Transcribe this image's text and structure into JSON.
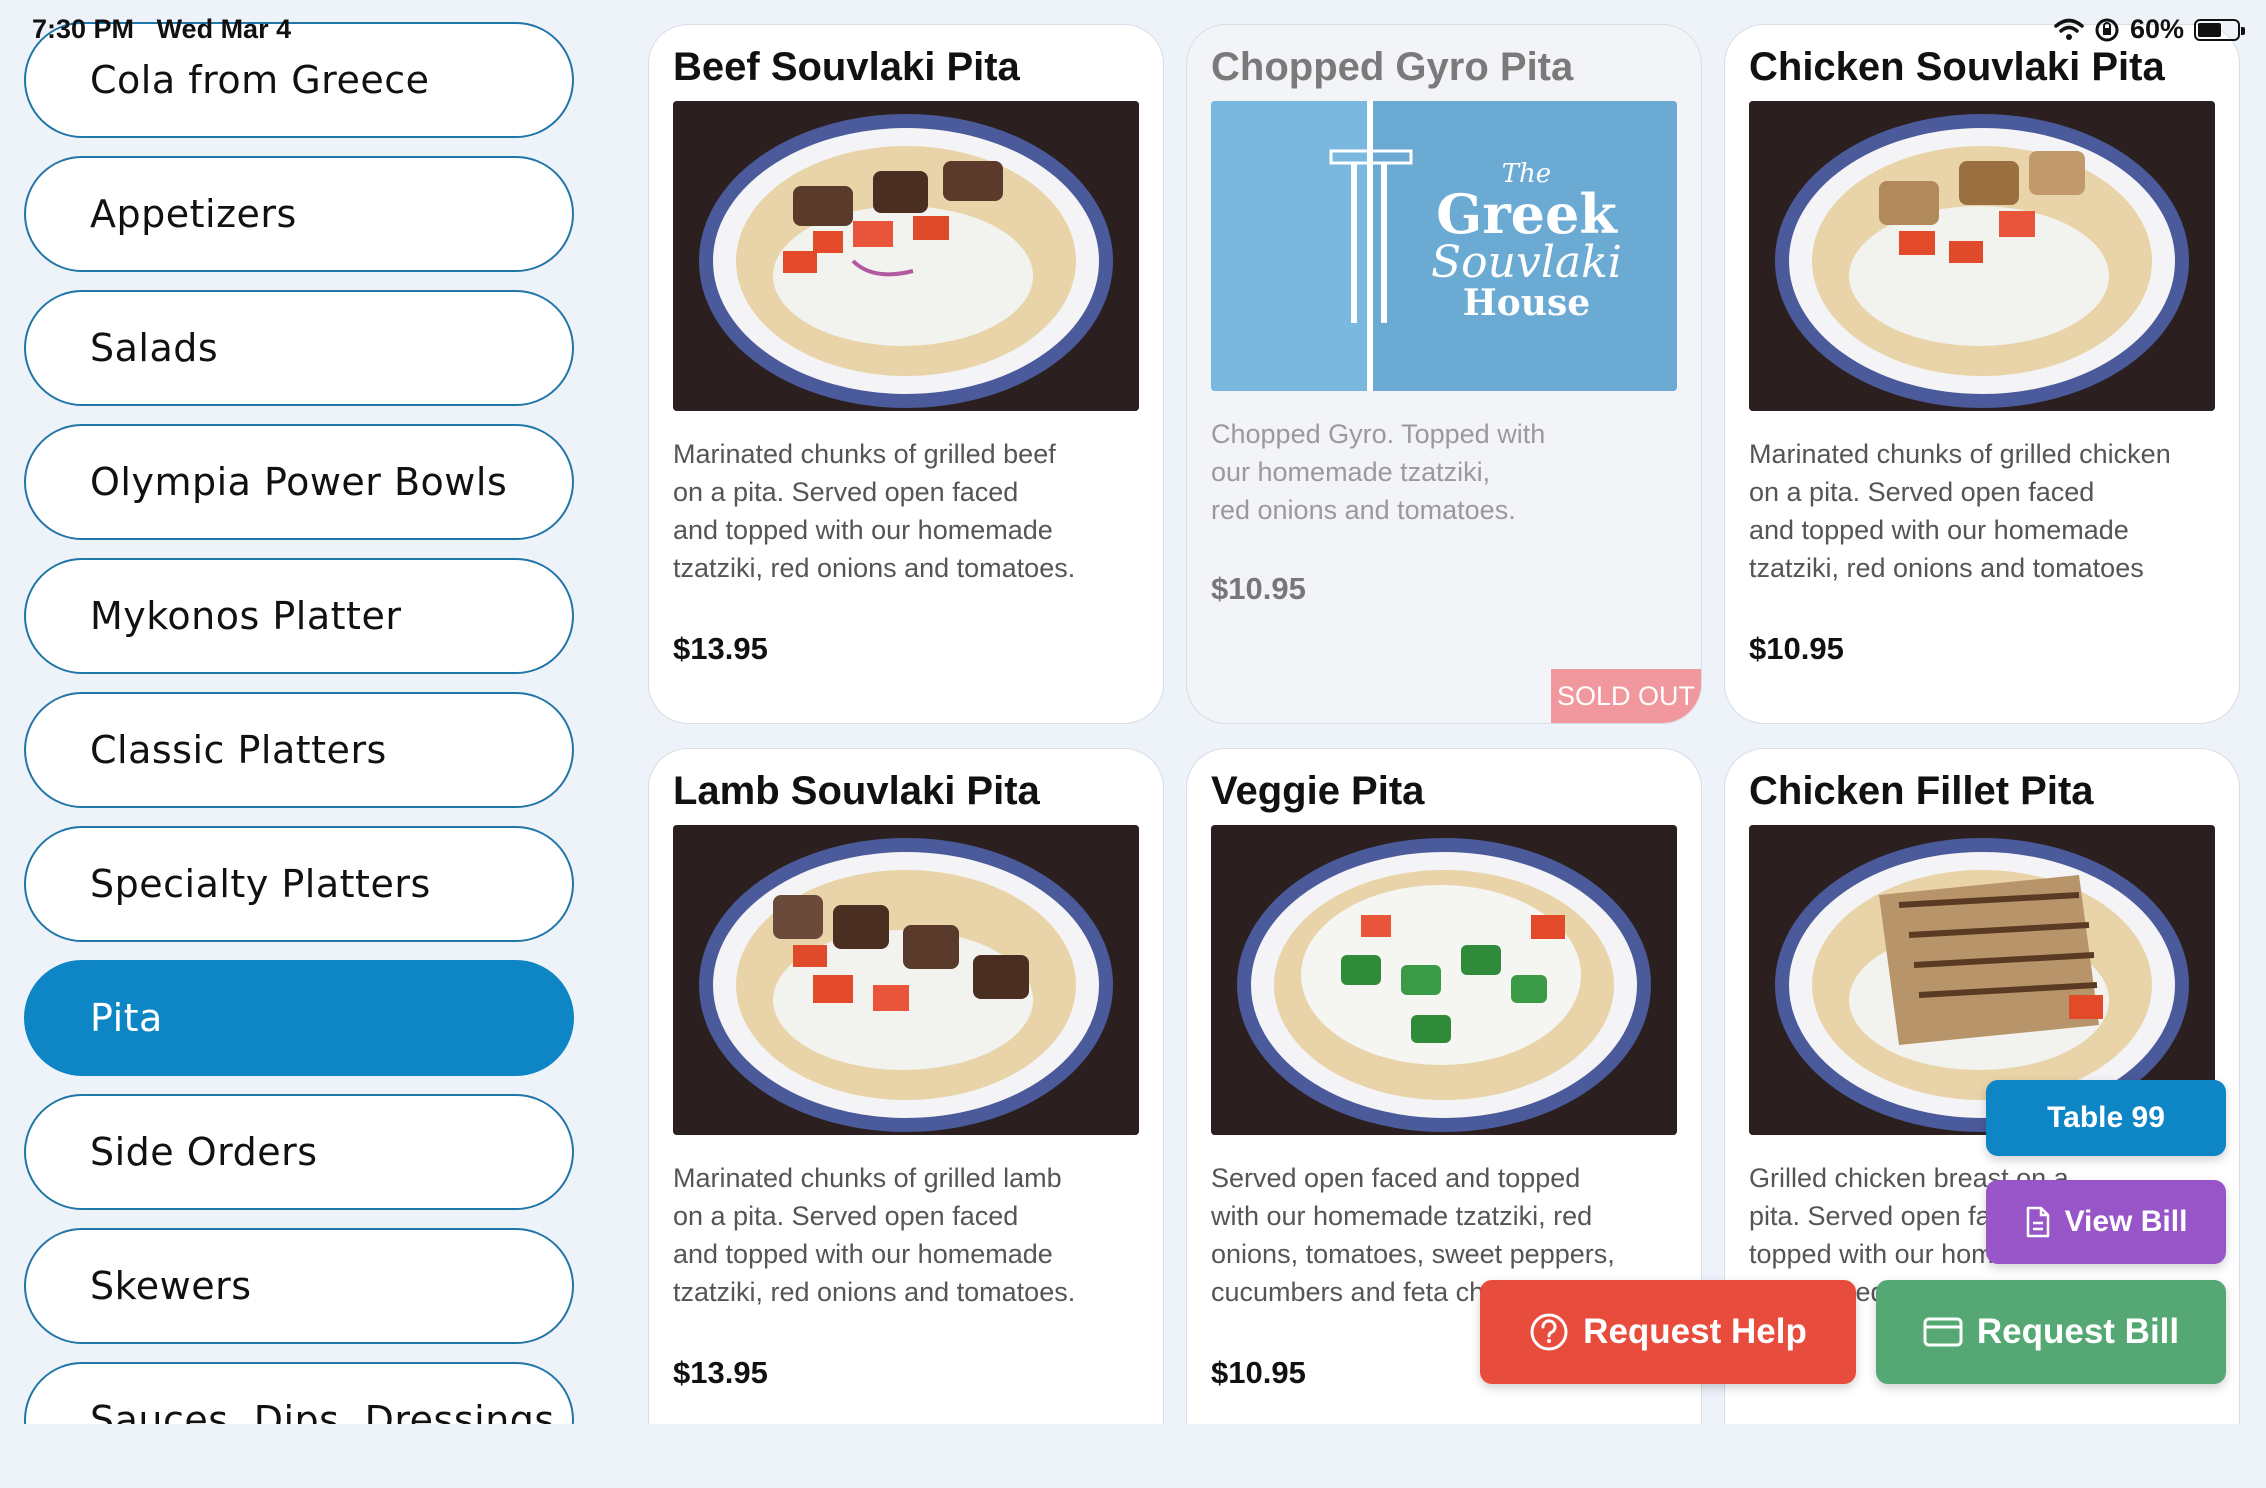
{
  "status_bar": {
    "time": "7:30 PM",
    "date": "Wed Mar 4",
    "battery": "60%"
  },
  "sidebar": {
    "items": [
      {
        "label": "Cola from Greece",
        "active": false
      },
      {
        "label": "Appetizers",
        "active": false
      },
      {
        "label": "Salads",
        "active": false
      },
      {
        "label": "Olympia Power Bowls",
        "active": false
      },
      {
        "label": "Mykonos Platter",
        "active": false
      },
      {
        "label": "Classic Platters",
        "active": false
      },
      {
        "label": "Specialty Platters",
        "active": false
      },
      {
        "label": "Pita",
        "active": true
      },
      {
        "label": "Side Orders",
        "active": false
      },
      {
        "label": "Skewers",
        "active": false
      },
      {
        "label": "Sauces, Dips, Dressings",
        "active": false
      }
    ]
  },
  "menu": {
    "items": [
      {
        "title": "Beef Souvlaki Pita",
        "description": "Marinated chunks of grilled beef\non a pita. Served open faced\nand topped with our homemade\ntzatziki, red onions and tomatoes.",
        "price": "$13.95",
        "sold_out": false
      },
      {
        "title": "Chopped Gyro Pita",
        "description": "Chopped Gyro. Topped with\nour homemade tzatziki,\nred onions and tomatoes.",
        "price": "$10.95",
        "sold_out": true,
        "sold_out_label": "SOLD OUT",
        "logo": {
          "top": "The",
          "line1": "Greek",
          "line2": "Souvlaki",
          "line3": "House"
        }
      },
      {
        "title": "Chicken Souvlaki Pita",
        "description": "Marinated chunks of grilled chicken\non a pita. Served open faced\nand topped with our homemade\ntzatziki, red onions and tomatoes",
        "price": "$10.95",
        "sold_out": false
      },
      {
        "title": "Lamb Souvlaki Pita",
        "description": "Marinated chunks of grilled lamb\non a pita. Served open faced\nand topped with our homemade\ntzatziki, red onions and tomatoes.",
        "price": "$13.95",
        "sold_out": false
      },
      {
        "title": "Veggie Pita",
        "description": "Served open faced and topped\nwith our homemade tzatziki, red\nonions, tomatoes, sweet peppers,\ncucumbers and feta cheese",
        "price": "$10.95",
        "sold_out": false
      },
      {
        "title": "Chicken Fillet Pita",
        "description": "Grilled chicken breast on a\npita. Served open faced and\ntopped with our homemade\ntzatziki, red onions and tomatoes",
        "price": "",
        "sold_out": false
      }
    ]
  },
  "actions": {
    "table": "Table 99",
    "view_bill": "View Bill",
    "request_help": "Request Help",
    "request_bill": "Request Bill"
  },
  "colors": {
    "accent": "#0e86c6",
    "view_bill": "#9855c7",
    "request_help": "#e84c3d",
    "request_bill": "#55a873",
    "sold_out": "#f0989e"
  }
}
